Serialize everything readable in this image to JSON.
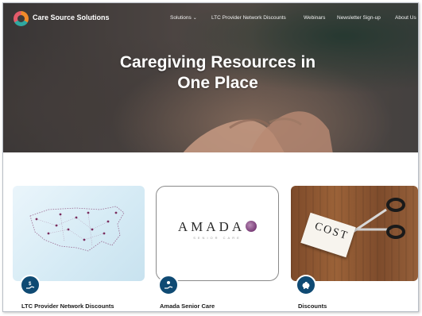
{
  "brand": {
    "name": "Care Source Solutions"
  },
  "nav": {
    "items": [
      {
        "label": "Solutions",
        "dropdown": true
      },
      {
        "label": "LTC Provider Network Discounts"
      },
      {
        "label": "Webinars"
      },
      {
        "label": "Newsletter Sign-up"
      },
      {
        "label": "About Us"
      }
    ],
    "chevron": "⌄"
  },
  "hero": {
    "title_line1": "Caregiving Resources in",
    "title_line2": "One Place"
  },
  "cards": [
    {
      "title": "LTC Provider Network Discounts",
      "icon": "dollar-hand-icon"
    },
    {
      "title": "Amada Senior Care",
      "icon": "person-hand-icon",
      "logo_text": "AMADA",
      "logo_subtext": "SENIOR CARE"
    },
    {
      "title": "Discounts",
      "icon": "piggy-bank-icon",
      "image_text": "COST"
    }
  ],
  "colors": {
    "icon_circle": "#0f4a73",
    "text": "#1a1a1a",
    "amada_accent": "#7a3d78"
  }
}
